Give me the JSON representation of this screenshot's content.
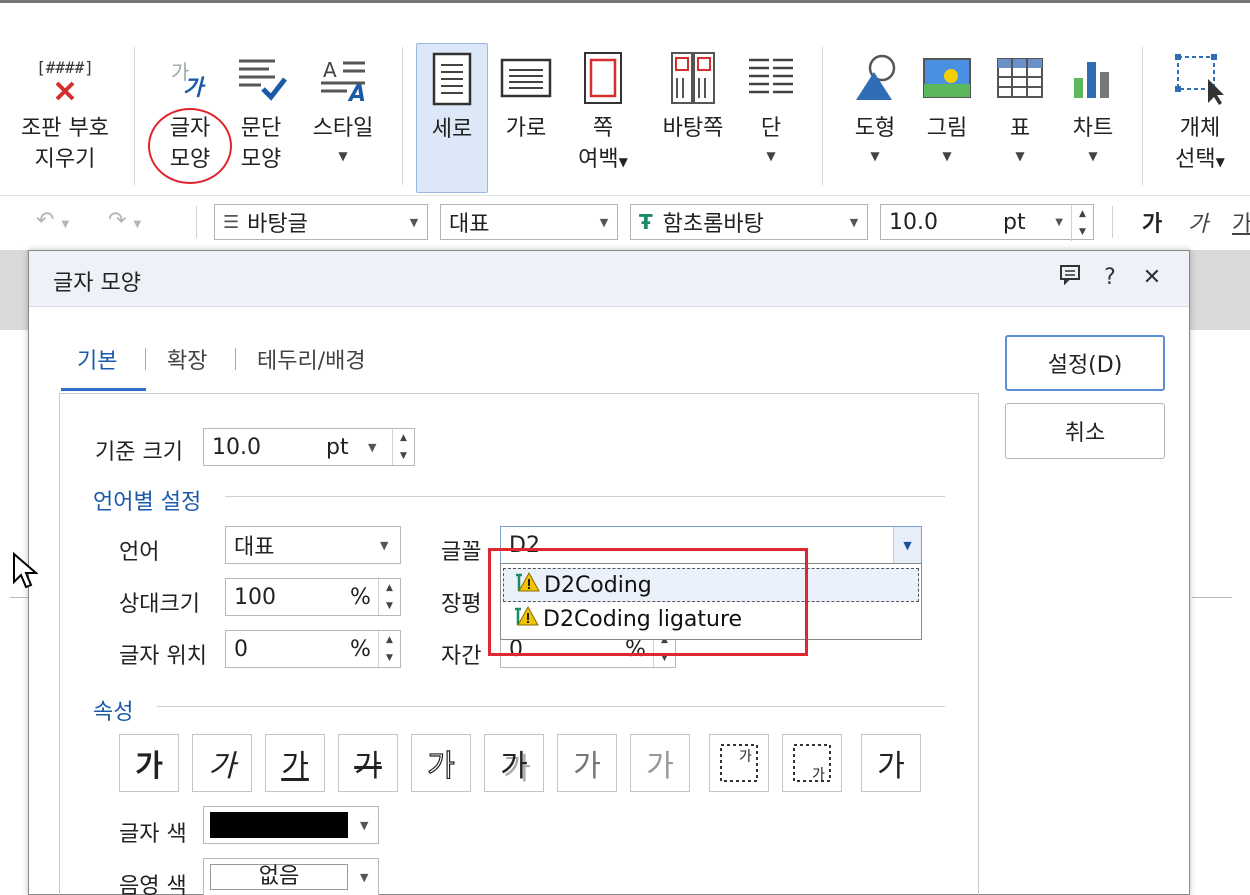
{
  "ribbon": {
    "items": [
      {
        "label1": "조판 부호",
        "label2": "지우기"
      },
      {
        "label1": "글자",
        "label2": "모양"
      },
      {
        "label1": "문단",
        "label2": "모양"
      },
      {
        "label1": "스타일",
        "label2": ""
      },
      {
        "label1": "세로",
        "label2": ""
      },
      {
        "label1": "가로",
        "label2": ""
      },
      {
        "label1": "쪽",
        "label2": "여백"
      },
      {
        "label1": "바탕쪽",
        "label2": ""
      },
      {
        "label1": "단",
        "label2": ""
      },
      {
        "label1": "도형",
        "label2": ""
      },
      {
        "label1": "그림",
        "label2": ""
      },
      {
        "label1": "표",
        "label2": ""
      },
      {
        "label1": "차트",
        "label2": ""
      },
      {
        "label1": "개체",
        "label2": "선택"
      }
    ]
  },
  "toolbar": {
    "style_value": "바탕글",
    "lang_value": "대표",
    "font_value": "함초롬바탕",
    "size_value": "10.0",
    "size_unit": "pt",
    "bold_glyph": "가",
    "italic_glyph": "가",
    "underline_glyph": "가"
  },
  "dialog": {
    "title": "글자 모양",
    "tabs": [
      "기본",
      "확장",
      "테두리/배경"
    ],
    "ok_label": "설정(D)",
    "cancel_label": "취소",
    "base_size_label": "기준 크기",
    "base_size_value": "10.0",
    "base_size_unit": "pt",
    "lang_section": "언어별 설정",
    "language_label": "언어",
    "language_value": "대표",
    "relsize_label": "상대크기",
    "relsize_value": "100",
    "pos_label": "글자 위치",
    "pos_value": "0",
    "percent": "%",
    "font_label": "글꼴",
    "font_value": "D2",
    "width_label": "장평",
    "spacing_label": "자간",
    "spacing_value": "0",
    "font_options": [
      "D2Coding",
      "D2Coding ligature"
    ],
    "attr_section": "속성",
    "attr_glyph": "가",
    "color_label": "글자 색",
    "color_value": "#000000",
    "shade_label": "음영 색",
    "shade_value": "없음"
  }
}
